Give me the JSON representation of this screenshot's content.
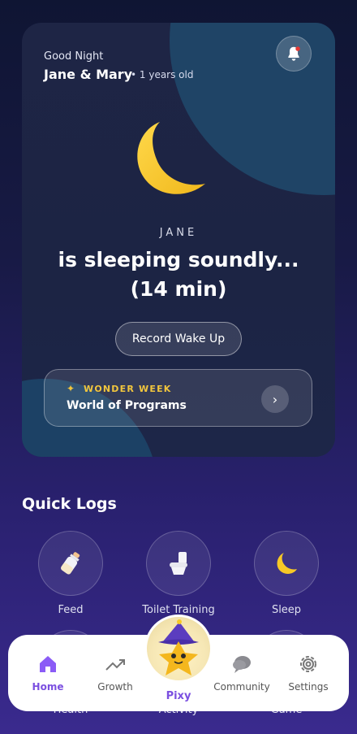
{
  "header": {
    "greeting": "Good Night",
    "names": "Jane & Mary",
    "age": "• 1 years old"
  },
  "sleep_card": {
    "child_name": "JANE",
    "status": "is sleeping soundly... (14 min)",
    "wake_button": "Record Wake Up"
  },
  "wonder_week": {
    "tag": "WONDER WEEK",
    "title": "World of Programs"
  },
  "quick_logs": {
    "title": "Quick Logs",
    "items": [
      {
        "label": "Feed",
        "icon": "bottle-icon"
      },
      {
        "label": "Toilet Training",
        "icon": "toilet-icon"
      },
      {
        "label": "Sleep",
        "icon": "moon-icon"
      },
      {
        "label": "Health",
        "icon": "health-icon"
      },
      {
        "label": "Activity",
        "icon": "activity-icon"
      },
      {
        "label": "Game",
        "icon": "game-icon"
      }
    ]
  },
  "nav": {
    "items": [
      {
        "label": "Home",
        "icon": "home-icon",
        "active": true
      },
      {
        "label": "Growth",
        "icon": "growth-icon"
      },
      {
        "label": "Pixy",
        "icon": "pixy-mascot"
      },
      {
        "label": "Community",
        "icon": "chat-icon"
      },
      {
        "label": "Settings",
        "icon": "gear-icon"
      }
    ]
  },
  "colors": {
    "accent": "#7b4fe0",
    "gold": "#f2c63d",
    "moon": "#f7c926"
  }
}
